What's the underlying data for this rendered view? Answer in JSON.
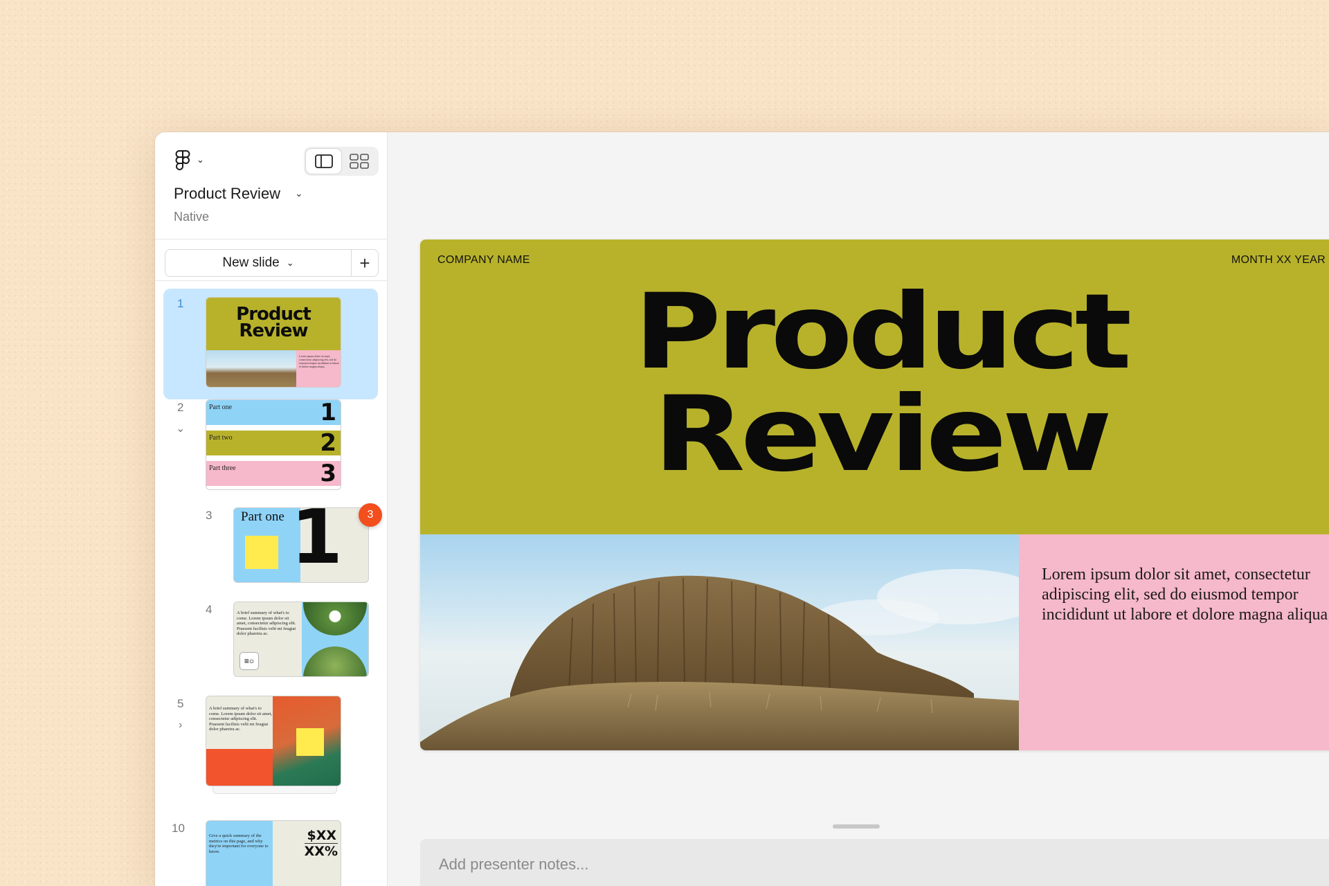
{
  "document": {
    "title": "Product Review",
    "subtitle": "Native"
  },
  "toolbar": {
    "new_slide_label": "New slide",
    "add_label": "+",
    "view_modes": [
      "single-view-icon",
      "grid-view-icon"
    ]
  },
  "slides": [
    {
      "number": "1",
      "title": "Product Review",
      "lorem": "Lorem ipsum dolor sit amet, consectetur adipiscing elit, sed do eiusmod tempor incididunt ut labore et dolore magna aliqua."
    },
    {
      "number": "2",
      "parts": [
        {
          "label": "Part one",
          "num": "1"
        },
        {
          "label": "Part two",
          "num": "2"
        },
        {
          "label": "Part three",
          "num": "3"
        }
      ]
    },
    {
      "number": "3",
      "label": "Part one",
      "big_num": "1",
      "comment_count": "3"
    },
    {
      "number": "4",
      "text": "A brief summary of what's to come. Lorem ipsum dolor sit amet, consectetur adipiscing elit. Praesent facilisis velit mi feugiat dolor pharetra ac."
    },
    {
      "number": "5",
      "text": "A brief summary of what's to come. Lorem ipsum dolor sit amet, consectetur adipiscing elit. Praesent facilisis velit mi feugiat dolor pharetra ac."
    },
    {
      "number": "10",
      "text": "Give a quick summary of the metrics on this page, and why they're important for everyone to know.",
      "metric_1": "$XX",
      "metric_2": "XX%"
    }
  ],
  "main_slide": {
    "company": "COMPANY NAME",
    "date": "MONTH XX YEAR",
    "title_line1": "Product",
    "title_line2": "Review",
    "body": "Lorem ipsum dolor sit amet, consectetur adipiscing elit, sed do eiusmod tempor incididunt ut labore et dolore magna aliqua."
  },
  "notes": {
    "placeholder": "Add presenter notes..."
  },
  "colors": {
    "olive": "#b8b22b",
    "pink": "#f6b8cb",
    "sky": "#8fd3f7",
    "badge": "#f24e1e",
    "selection": "#c7e6ff"
  }
}
